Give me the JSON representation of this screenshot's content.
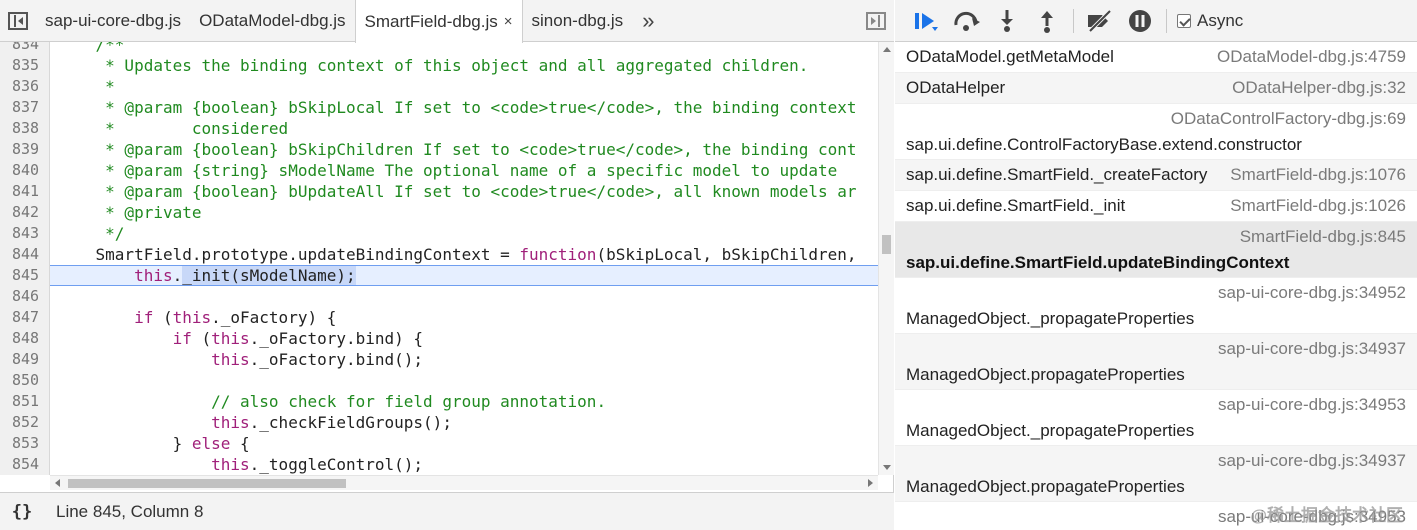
{
  "editor": {
    "tabs": [
      {
        "label": "sap-ui-core-dbg.js"
      },
      {
        "label": "ODataModel-dbg.js"
      },
      {
        "label": "SmartField-dbg.js",
        "close": "×"
      },
      {
        "label": "sinon-dbg.js"
      }
    ],
    "more_tabs_glyph": "»",
    "lines": [
      {
        "num": "834",
        "text": "    /**"
      },
      {
        "num": "835",
        "text": "     * Updates the binding context of this object and all aggregated children."
      },
      {
        "num": "836",
        "text": "     *"
      },
      {
        "num": "837",
        "text": "     * @param {boolean} bSkipLocal If set to <code>true</code>, the binding context"
      },
      {
        "num": "838",
        "text": "     *        considered"
      },
      {
        "num": "839",
        "text": "     * @param {boolean} bSkipChildren If set to <code>true</code>, the binding cont"
      },
      {
        "num": "840",
        "text": "     * @param {string} sModelName The optional name of a specific model to update"
      },
      {
        "num": "841",
        "text": "     * @param {boolean} bUpdateAll If set to <code>true</code>, all known models ar"
      },
      {
        "num": "842",
        "text": "     * @private"
      },
      {
        "num": "843",
        "text": "     */"
      },
      {
        "num": "844",
        "text": "    SmartField.prototype.updateBindingContext = function(bSkipLocal, bSkipChildren,"
      },
      {
        "num": "845",
        "text": "        this._init(sModelName);"
      },
      {
        "num": "846",
        "text": ""
      },
      {
        "num": "847",
        "text": "        if (this._oFactory) {"
      },
      {
        "num": "848",
        "text": "            if (this._oFactory.bind) {"
      },
      {
        "num": "849",
        "text": "                this._oFactory.bind();"
      },
      {
        "num": "850",
        "text": ""
      },
      {
        "num": "851",
        "text": "                // also check for field group annotation."
      },
      {
        "num": "852",
        "text": "                this._checkFieldGroups();"
      },
      {
        "num": "853",
        "text": "            } else {"
      },
      {
        "num": "854",
        "text": "                this._toggleControl();"
      },
      {
        "num": "855",
        "text": "            }"
      }
    ],
    "current_line": "845",
    "status": {
      "braces": "{}",
      "position": "Line 845, Column 8"
    }
  },
  "debugger": {
    "async_label": "Async",
    "async_checked": true,
    "toolbar_icons": [
      "resume-icon",
      "step-over-icon",
      "step-into-icon",
      "step-out-icon",
      "deactivate-breakpoints-icon",
      "pause-on-exceptions-icon"
    ],
    "call_stack": [
      {
        "fn": "ODataModel.getMetaModel",
        "loc": "ODataModel-dbg.js:4759",
        "rows": 1
      },
      {
        "fn": "ODataHelper",
        "loc": "ODataHelper-dbg.js:32",
        "rows": 1
      },
      {
        "fn": "sap.ui.define.ControlFactoryBase.extend.constructor",
        "loc": "ODataControlFactory-dbg.js:69",
        "rows": 2
      },
      {
        "fn": "sap.ui.define.SmartField._createFactory",
        "loc": "SmartField-dbg.js:1076",
        "rows": 1
      },
      {
        "fn": "sap.ui.define.SmartField._init",
        "loc": "SmartField-dbg.js:1026",
        "rows": 1
      },
      {
        "fn": "sap.ui.define.SmartField.updateBindingContext",
        "loc": "SmartField-dbg.js:845",
        "rows": 2,
        "selected": true
      },
      {
        "fn": "ManagedObject._propagateProperties",
        "loc": "sap-ui-core-dbg.js:34952",
        "rows": 2
      },
      {
        "fn": "ManagedObject.propagateProperties",
        "loc": "sap-ui-core-dbg.js:34937",
        "rows": 2
      },
      {
        "fn": "ManagedObject._propagateProperties",
        "loc": "sap-ui-core-dbg.js:34953",
        "rows": 2
      },
      {
        "fn": "ManagedObject.propagateProperties",
        "loc": "sap-ui-core-dbg.js:34937",
        "rows": 2
      },
      {
        "fn": "",
        "loc": "sap-ui-core-dbg.js:34953",
        "rows": 1
      }
    ],
    "watermark": "@稀土掘金技术社区"
  },
  "colors": {
    "comment": "#208a20",
    "keyword": "#a0207a",
    "accent_blue": "#1a73e8",
    "current_line": "#e6efff"
  }
}
